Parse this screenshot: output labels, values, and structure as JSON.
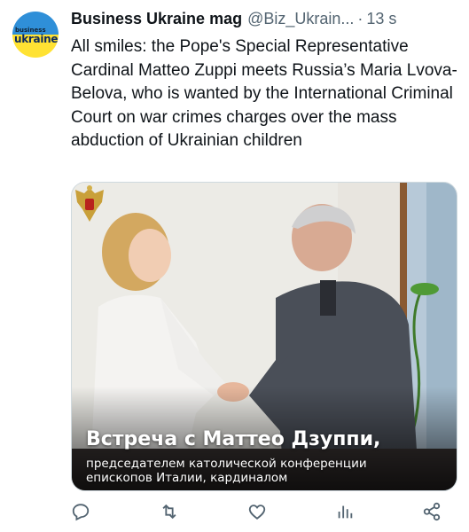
{
  "tweet": {
    "display_name": "Business Ukraine mag",
    "handle": "@Biz_Ukrain...",
    "separator": "·",
    "time": "13 s",
    "more_label": "···",
    "text": "All smiles: the Pope's Special Representative Cardinal Matteo Zuppi meets Russia’s Maria Lvova-Belova, who is wanted by the International Criminal Court on war crimes charges over the mass abduction of Ukrainian children"
  },
  "avatar": {
    "small_text": "business",
    "big_text": "ukraine",
    "top_color": "#2f8fd8",
    "bottom_color": "#ffe233"
  },
  "media": {
    "caption_title": "Встреча с Маттео Дзуппи,",
    "caption_subtitle": "председателем католической конференции епископов Италии, кардиналом"
  },
  "actions": {
    "icons": [
      "reply-icon",
      "retweet-icon",
      "like-icon",
      "views-icon",
      "share-icon"
    ],
    "icon_color": "#536471"
  }
}
